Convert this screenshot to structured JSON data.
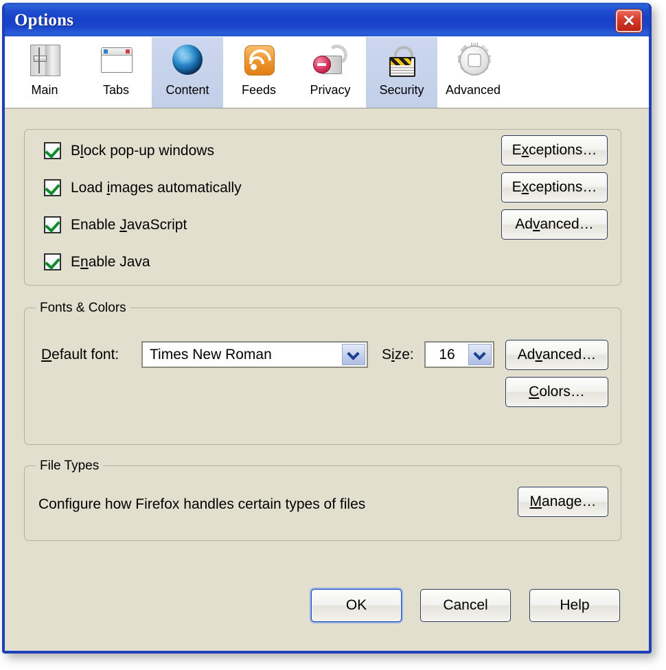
{
  "window": {
    "title": "Options",
    "close_label": "✕",
    "close_icon": "close-icon"
  },
  "colors": {
    "titlebar_blue": "#1741c6",
    "window_border": "#1c3fba",
    "pane_background": "#E2DFCE",
    "selected_tab": "#c6d2ea",
    "check_green": "#0f8a28",
    "close_red": "#d8392a",
    "focus_ring": "#8fb3e0"
  },
  "toolbar": {
    "tabs": [
      {
        "label": "Main",
        "icon": "main-preferences-icon",
        "selected": false
      },
      {
        "label": "Tabs",
        "icon": "tabs-window-icon",
        "selected": false
      },
      {
        "label": "Content",
        "icon": "content-globe-icon",
        "selected": true
      },
      {
        "label": "Feeds",
        "icon": "feeds-rss-icon",
        "selected": false
      },
      {
        "label": "Privacy",
        "icon": "privacy-unlocked-padlock-icon",
        "selected": false
      },
      {
        "label": "Security",
        "icon": "security-padlock-icon",
        "selected": true
      },
      {
        "label": "Advanced",
        "icon": "advanced-gear-icon",
        "selected": false
      }
    ]
  },
  "content": {
    "checkboxes": [
      {
        "label_before": "B",
        "accel": "l",
        "label_after": "ock pop-up windows",
        "checked": true,
        "name": "block-popups"
      },
      {
        "label_before": "Load ",
        "accel": "i",
        "label_after": "mages automatically",
        "checked": true,
        "name": "load-images"
      },
      {
        "label_before": "Enable ",
        "accel": "J",
        "label_after": "avaScript",
        "checked": true,
        "name": "enable-javascript"
      },
      {
        "label_before": "E",
        "accel": "n",
        "label_after": "able Java",
        "checked": true,
        "name": "enable-java"
      }
    ],
    "checkbox_buttons": [
      {
        "before": "E",
        "accel": "x",
        "after": "ceptions…",
        "name": "popup-exceptions-button"
      },
      {
        "before": "E",
        "accel": "x",
        "after": "ceptions…",
        "name": "image-exceptions-button"
      },
      {
        "before": "Ad",
        "accel": "v",
        "after": "anced…",
        "name": "javascript-advanced-button"
      }
    ],
    "fonts_group": {
      "title": "Fonts & Colors",
      "font_label_before": "",
      "font_label_accel": "D",
      "font_label_after": "efault font:",
      "font_value": "Times New Roman",
      "size_label_before": "S",
      "size_label_accel": "i",
      "size_label_after": "ze:",
      "size_value": "16",
      "advanced_before": "Ad",
      "advanced_accel": "v",
      "advanced_after": "anced…",
      "colors_before": "",
      "colors_accel": "C",
      "colors_after": "olors…"
    },
    "filetypes_group": {
      "title": "File Types",
      "description": "Configure how Firefox handles certain types of files",
      "manage_before": "",
      "manage_accel": "M",
      "manage_after": "anage…"
    }
  },
  "footer": {
    "ok_label": "OK",
    "cancel_label": "Cancel",
    "help_label": "Help"
  }
}
